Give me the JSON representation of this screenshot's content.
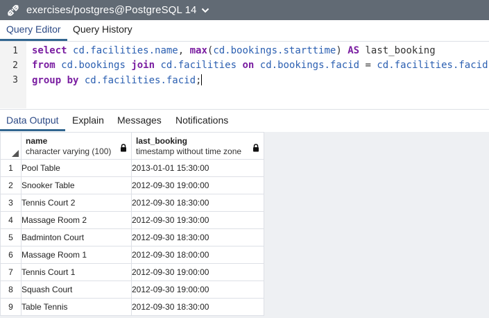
{
  "titlebar": {
    "connection": "exercises/postgres@PostgreSQL 14",
    "icons": [
      "connection-icon",
      "chevron-down-icon"
    ]
  },
  "editor_tabs": [
    {
      "label": "Query Editor",
      "active": true
    },
    {
      "label": "Query History",
      "active": false
    }
  ],
  "editor": {
    "line_numbers": [
      "1",
      "2",
      "3"
    ],
    "lines": [
      [
        {
          "t": "select",
          "c": "kw"
        },
        {
          "t": " ",
          "c": "op"
        },
        {
          "t": "cd.facilities.name",
          "c": "id"
        },
        {
          "t": ", ",
          "c": "op"
        },
        {
          "t": "max",
          "c": "kw"
        },
        {
          "t": "(",
          "c": "op"
        },
        {
          "t": "cd.bookings.starttime",
          "c": "id"
        },
        {
          "t": ") ",
          "c": "op"
        },
        {
          "t": "AS",
          "c": "kw"
        },
        {
          "t": " last_booking",
          "c": "op"
        }
      ],
      [
        {
          "t": "from",
          "c": "kw"
        },
        {
          "t": " ",
          "c": "op"
        },
        {
          "t": "cd.bookings",
          "c": "id"
        },
        {
          "t": " ",
          "c": "op"
        },
        {
          "t": "join",
          "c": "kw"
        },
        {
          "t": " ",
          "c": "op"
        },
        {
          "t": "cd.facilities",
          "c": "id"
        },
        {
          "t": " ",
          "c": "op"
        },
        {
          "t": "on",
          "c": "kw"
        },
        {
          "t": " ",
          "c": "op"
        },
        {
          "t": "cd.bookings.facid",
          "c": "id"
        },
        {
          "t": " = ",
          "c": "op"
        },
        {
          "t": "cd.facilities.facid",
          "c": "id"
        }
      ],
      [
        {
          "t": "group by",
          "c": "kw"
        },
        {
          "t": " ",
          "c": "op"
        },
        {
          "t": "cd.facilities.facid",
          "c": "id"
        },
        {
          "t": ";",
          "c": "op"
        }
      ]
    ]
  },
  "output_tabs": [
    {
      "label": "Data Output",
      "active": true
    },
    {
      "label": "Explain",
      "active": false
    },
    {
      "label": "Messages",
      "active": false
    },
    {
      "label": "Notifications",
      "active": false
    }
  ],
  "grid": {
    "columns": [
      {
        "name": "name",
        "type": "character varying (100)"
      },
      {
        "name": "last_booking",
        "type": "timestamp without time zone"
      }
    ],
    "rows": [
      {
        "num": "1",
        "name": "Pool Table",
        "last_booking": "2013-01-01 15:30:00"
      },
      {
        "num": "2",
        "name": "Snooker Table",
        "last_booking": "2012-09-30 19:00:00"
      },
      {
        "num": "3",
        "name": "Tennis Court 2",
        "last_booking": "2012-09-30 18:30:00"
      },
      {
        "num": "4",
        "name": "Massage Room 2",
        "last_booking": "2012-09-30 19:30:00"
      },
      {
        "num": "5",
        "name": "Badminton Court",
        "last_booking": "2012-09-30 18:30:00"
      },
      {
        "num": "6",
        "name": "Massage Room 1",
        "last_booking": "2012-09-30 18:00:00"
      },
      {
        "num": "7",
        "name": "Tennis Court 1",
        "last_booking": "2012-09-30 19:00:00"
      },
      {
        "num": "8",
        "name": "Squash Court",
        "last_booking": "2012-09-30 19:00:00"
      },
      {
        "num": "9",
        "name": "Table Tennis",
        "last_booking": "2012-09-30 18:30:00"
      }
    ]
  },
  "colors": {
    "titlebar_bg": "#616a74",
    "active_tab_text": "#2c4a86",
    "active_tab_underline": "#326690",
    "keyword": "#7a1ea1",
    "identifier": "#2b5fb1"
  }
}
